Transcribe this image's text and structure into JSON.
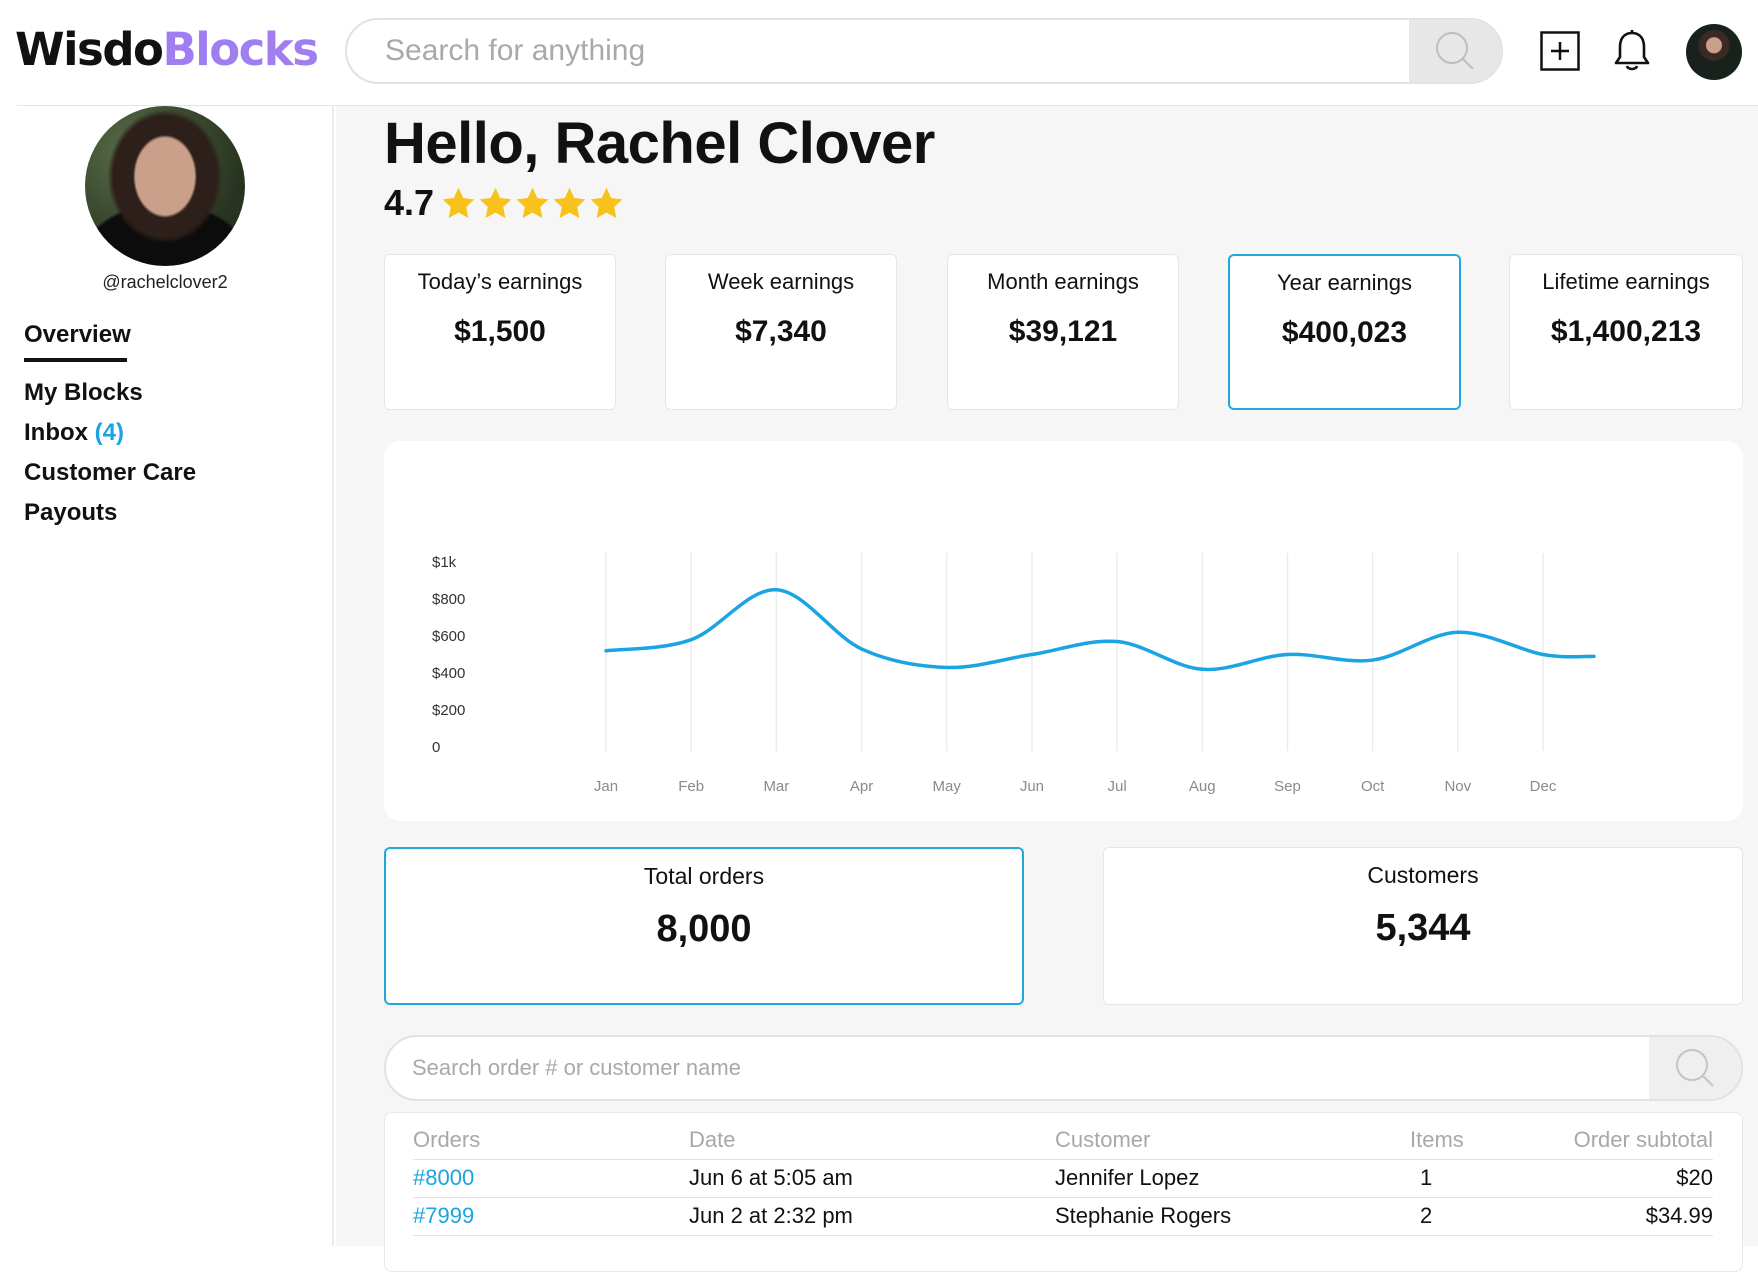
{
  "brand": {
    "part1": "Wisdo",
    "part2": "Blocks"
  },
  "header": {
    "search_placeholder": "Search for anything"
  },
  "sidebar": {
    "username": "@rachelclover2",
    "items": [
      {
        "label": "Overview"
      },
      {
        "label": "My Blocks"
      },
      {
        "label": "Inbox",
        "badge": "(4)"
      },
      {
        "label": "Customer Care"
      },
      {
        "label": "Payouts"
      }
    ]
  },
  "main": {
    "greeting": "Hello, Rachel Clover",
    "rating": "4.7",
    "stars": 5,
    "earnings": [
      {
        "label": "Today’s earnings",
        "value": "$1,500"
      },
      {
        "label": "Week earnings",
        "value": "$7,340"
      },
      {
        "label": "Month earnings",
        "value": "$39,121"
      },
      {
        "label": "Year earnings",
        "value": "$400,023",
        "selected": true
      },
      {
        "label": "Lifetime earnings",
        "value": "$1,400,213"
      }
    ],
    "totals": [
      {
        "label": "Total orders",
        "value": "8,000",
        "selected": true
      },
      {
        "label": "Customers",
        "value": "5,344"
      }
    ],
    "orders_search_placeholder": "Search order # or customer name",
    "orders_table": {
      "columns": [
        "Orders",
        "Date",
        "Customer",
        "Items",
        "Order subtotal"
      ],
      "rows": [
        [
          "#8000",
          "Jun 6 at 5:05 am",
          "Jennifer Lopez",
          "1",
          "$20"
        ],
        [
          "#7999",
          "Jun 2 at 2:32 pm",
          "Stephanie Rogers",
          "2",
          "$34.99"
        ]
      ]
    }
  },
  "colors": {
    "accent": "#1ba4e3",
    "brand_purple": "#a07ef0",
    "star": "#f7c21b",
    "selected_border": "#22a8e0"
  },
  "chart_data": {
    "type": "line",
    "x": [
      "Jan",
      "Feb",
      "Mar",
      "Apr",
      "May",
      "Jun",
      "Jul",
      "Aug",
      "Sep",
      "Oct",
      "Nov",
      "Dec"
    ],
    "yticks": [
      "0",
      "$200",
      "$400",
      "$600",
      "$800",
      "$1k"
    ],
    "ylim": [
      0,
      1000
    ],
    "series": [
      {
        "color": "#1ba4e3",
        "points": [
          [
            "Jan",
            520
          ],
          [
            "Feb",
            580
          ],
          [
            "Mar",
            850
          ],
          [
            "Apr",
            530
          ],
          [
            "May",
            430
          ],
          [
            "Jun",
            500
          ],
          [
            "Jul",
            570
          ],
          [
            "Aug",
            420
          ],
          [
            "Sep",
            500
          ],
          [
            "Oct",
            470
          ],
          [
            "Nov",
            620
          ],
          [
            "Dec",
            500
          ]
        ]
      }
    ],
    "grid": "vertical"
  }
}
